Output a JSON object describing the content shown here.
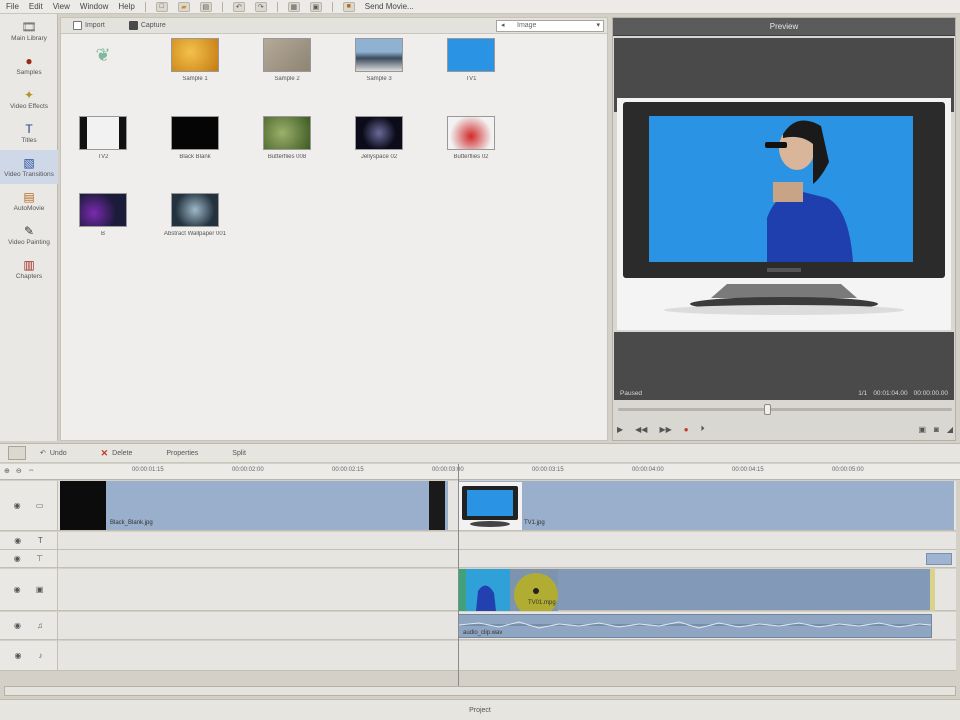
{
  "menu": {
    "items": [
      "File",
      "Edit",
      "View",
      "Window",
      "Help"
    ],
    "share_label": "Send Movie..."
  },
  "categories": [
    {
      "label": "Main Library",
      "icon": "film-strip-icon"
    },
    {
      "label": "Samples",
      "icon": "apple-icon"
    },
    {
      "label": "Video Effects",
      "icon": "effects-wand-icon"
    },
    {
      "label": "Titles",
      "icon": "titles-icon"
    },
    {
      "label": "Video Transitions",
      "icon": "transitions-icon"
    },
    {
      "label": "AutoMovie",
      "icon": "automovie-icon"
    },
    {
      "label": "Video Painting",
      "icon": "paint-brush-icon"
    },
    {
      "label": "Chapters",
      "icon": "chapters-icon"
    }
  ],
  "browser": {
    "toolbar": {
      "import_label": "Import",
      "capture_label": "Capture",
      "dropdown_value": "Image"
    },
    "items": [
      {
        "label": "",
        "kind": "blank"
      },
      {
        "label": "Sample 1",
        "kind": "orange"
      },
      {
        "label": "Sample 2",
        "kind": "stone"
      },
      {
        "label": "Sample 3",
        "kind": "mountain"
      },
      {
        "label": "TV1",
        "kind": "tv"
      },
      {
        "label": "TV2",
        "kind": "film"
      },
      {
        "label": "Black Blank",
        "kind": "black"
      },
      {
        "label": "Butterflies 008",
        "kind": "green"
      },
      {
        "label": "Jellyspace 02",
        "kind": "space"
      },
      {
        "label": "Butterflies 02",
        "kind": "red"
      },
      {
        "label": "B",
        "kind": "purple"
      },
      {
        "label": "Abstract Wallpaper 001",
        "kind": "abstract"
      }
    ]
  },
  "preview": {
    "title": "Preview",
    "status_left": "Paused",
    "status_a": "1/1",
    "status_b": "00:01:04.00",
    "status_c": "00:00:00.00"
  },
  "timeline": {
    "toolbar": {
      "undo_label": "Undo",
      "delete_label": "Delete",
      "properties_label": "Properties",
      "split_label": "Split"
    },
    "ruler_ticks": [
      "00:00:01:15",
      "00:00:02:00",
      "00:00:02:15",
      "00:00:03:00",
      "00:00:03:15",
      "00:00:04:00",
      "00:00:04:15",
      "00:00:05:00"
    ],
    "clips": {
      "black_blank": "Black_Blank.jpg",
      "tv1": "TV1.jpg",
      "overlay_video": "TV01.mpg",
      "audio": "audio_clip.wav"
    }
  },
  "status_bar": {
    "label": "Project"
  }
}
